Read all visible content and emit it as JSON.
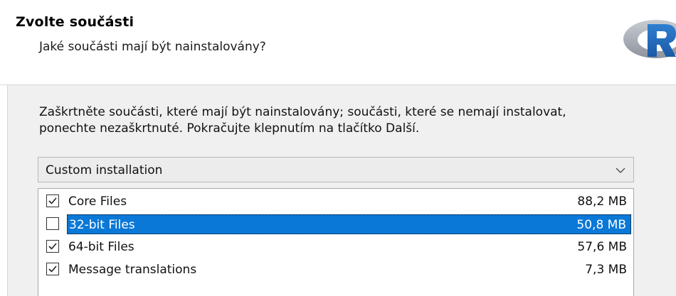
{
  "header": {
    "title": "Zvolte součásti",
    "subtitle": "Jaké součásti mají být nainstalovány?",
    "logo_icon": "r-logo-icon",
    "logo_letter": "R"
  },
  "instructions": {
    "line1": "Zaškrtněte součásti, které mají být nainstalovány; součásti, které se nemají instalovat,",
    "line2": "ponechte nezaškrtnuté. Pokračujte klepnutím na tlačítko Další."
  },
  "install_type": {
    "value": "Custom installation",
    "arrow_icon": "chevron-down-icon"
  },
  "components": [
    {
      "name": "Core Files",
      "size": "88,2 MB",
      "checked": true,
      "selected": false
    },
    {
      "name": "32-bit Files",
      "size": "50,8 MB",
      "checked": false,
      "selected": true
    },
    {
      "name": "64-bit Files",
      "size": "57,6 MB",
      "checked": true,
      "selected": false
    },
    {
      "name": "Message translations",
      "size": "7,3 MB",
      "checked": true,
      "selected": false
    }
  ],
  "colors": {
    "selection": "#0a78d7",
    "logo_ring": "#a9adb6",
    "logo_letter": "#1f66b5"
  }
}
